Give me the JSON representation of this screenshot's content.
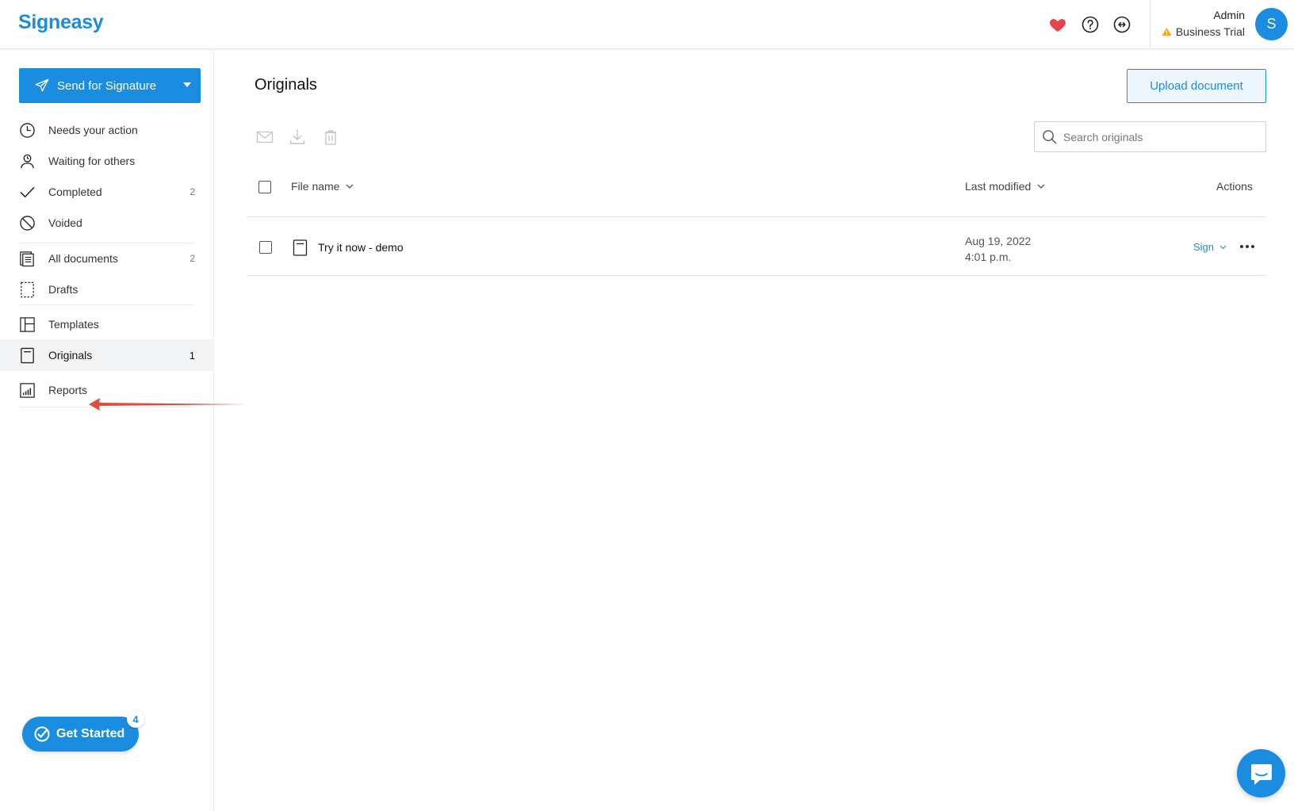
{
  "app": {
    "logo": "Signeasy"
  },
  "header": {
    "icons": [
      "heart-icon",
      "help-icon",
      "refer-icon"
    ],
    "user": {
      "name": "Admin",
      "plan": "Business Trial",
      "avatar_initial": "S"
    },
    "colors": {
      "brand": "#1a8de0",
      "heart": "#e8424c",
      "warning": "#f5a623"
    }
  },
  "sidebar": {
    "send_button": {
      "label": "Send for Signature"
    },
    "items": [
      {
        "label": "Needs your action",
        "icon": "clock-icon",
        "count": ""
      },
      {
        "label": "Waiting for others",
        "icon": "person-clock-icon",
        "count": ""
      },
      {
        "label": "Completed",
        "icon": "check-icon",
        "count": "2"
      },
      {
        "label": "Voided",
        "icon": "void-icon",
        "count": ""
      },
      {
        "label": "All documents",
        "icon": "documents-icon",
        "count": "2"
      },
      {
        "label": "Drafts",
        "icon": "draft-icon",
        "count": ""
      },
      {
        "label": "Templates",
        "icon": "template-icon",
        "count": ""
      },
      {
        "label": "Originals",
        "icon": "original-icon",
        "count": "1",
        "active": true
      },
      {
        "label": "Reports",
        "icon": "reports-icon",
        "count": ""
      }
    ],
    "get_started": {
      "label": "Get Started",
      "badge": "4"
    }
  },
  "main": {
    "title": "Originals",
    "upload_label": "Upload document",
    "toolbar_icons": [
      "email-icon",
      "download-icon",
      "trash-icon"
    ],
    "search": {
      "placeholder": "Search originals",
      "value": ""
    },
    "table": {
      "columns": {
        "file_name": "File name",
        "last_modified": "Last modified",
        "actions": "Actions"
      },
      "rows": [
        {
          "name": "Try it now - demo",
          "date": "Aug 19, 2022",
          "time": "4:01 p.m.",
          "action": "Sign"
        }
      ]
    }
  }
}
